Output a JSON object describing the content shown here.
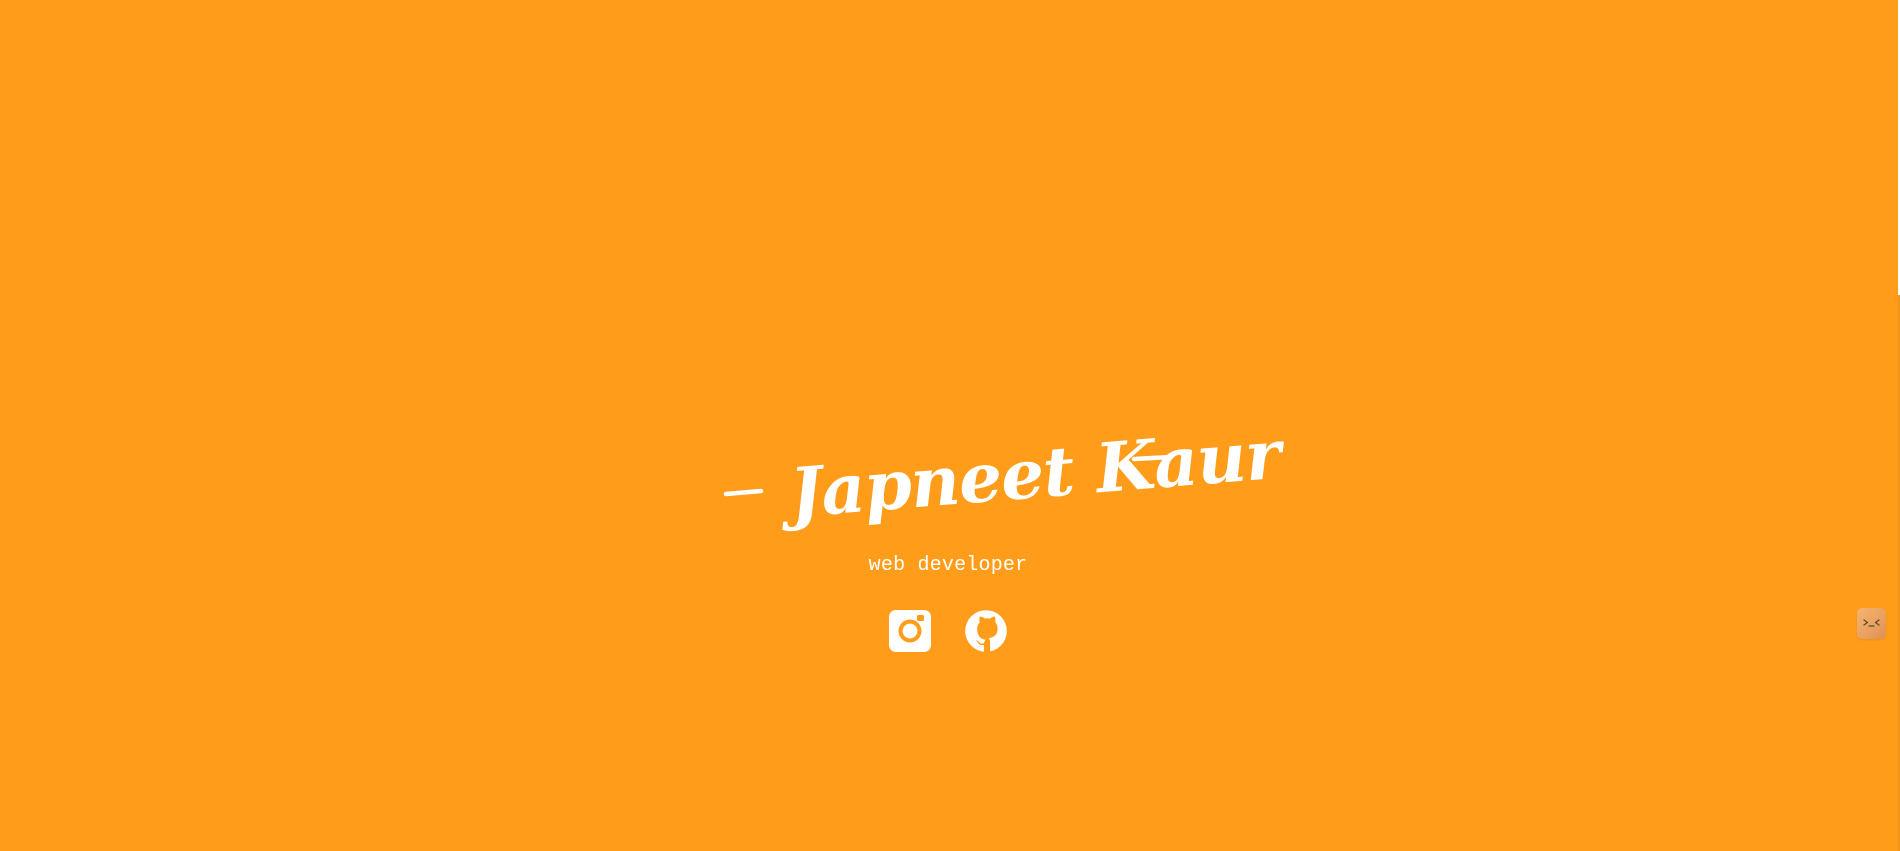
{
  "page": {
    "background_color": "#ff9d1b",
    "text_color": "#ffffff"
  },
  "hero": {
    "name": "Japneet Kaur",
    "subtitle": "web developer"
  },
  "social": {
    "links": [
      {
        "icon": "instagram-icon"
      },
      {
        "icon": "github-icon"
      }
    ]
  },
  "side_widget": {
    "icon": "emoji-face-icon"
  }
}
